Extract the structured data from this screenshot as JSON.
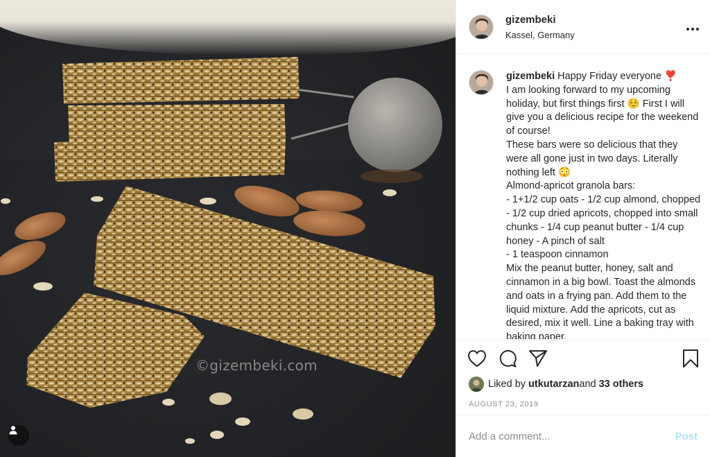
{
  "post": {
    "username": "gizembeki",
    "location": "Kassel, Germany",
    "more_icon": "more-horizontal-icon",
    "watermark": "©gizembeki.com",
    "caption_username": "gizembeki",
    "caption_text": " Happy Friday everyone ❣️\nI am looking forward to my upcoming holiday, but first things first ☺️ First I will give you a delicious recipe for the weekend of course!\nThese bars were so delicious that they were all gone just in two days. Literally nothing left 😳\nAlmond-apricot granola bars:\n- 1+1/2 cup oats - 1/2 cup almond, chopped - 1/2 cup dried apricots, chopped into small chunks - 1/4 cup peanut butter - 1/4 cup honey - A pinch of salt\n- 1 teaspoon cinnamon\nMix the peanut butter, honey, salt and cinnamon in a big bowl. Toast the almonds and oats in a frying pan. Add them to the liquid mixture. Add the apricots, cut as desired, mix it well. Line a baking tray with baking paper."
  },
  "actions": {
    "like_icon": "heart-icon",
    "comment_icon": "comment-icon",
    "share_icon": "send-icon",
    "save_icon": "bookmark-icon"
  },
  "likes": {
    "prefix": "Liked by ",
    "user": "utkutarzan",
    "middle": " and ",
    "others": "33 others"
  },
  "date": "AUGUST 23, 2019",
  "comment": {
    "placeholder": "Add a comment...",
    "post_label": "Post",
    "post_color": "#b2dffc"
  }
}
